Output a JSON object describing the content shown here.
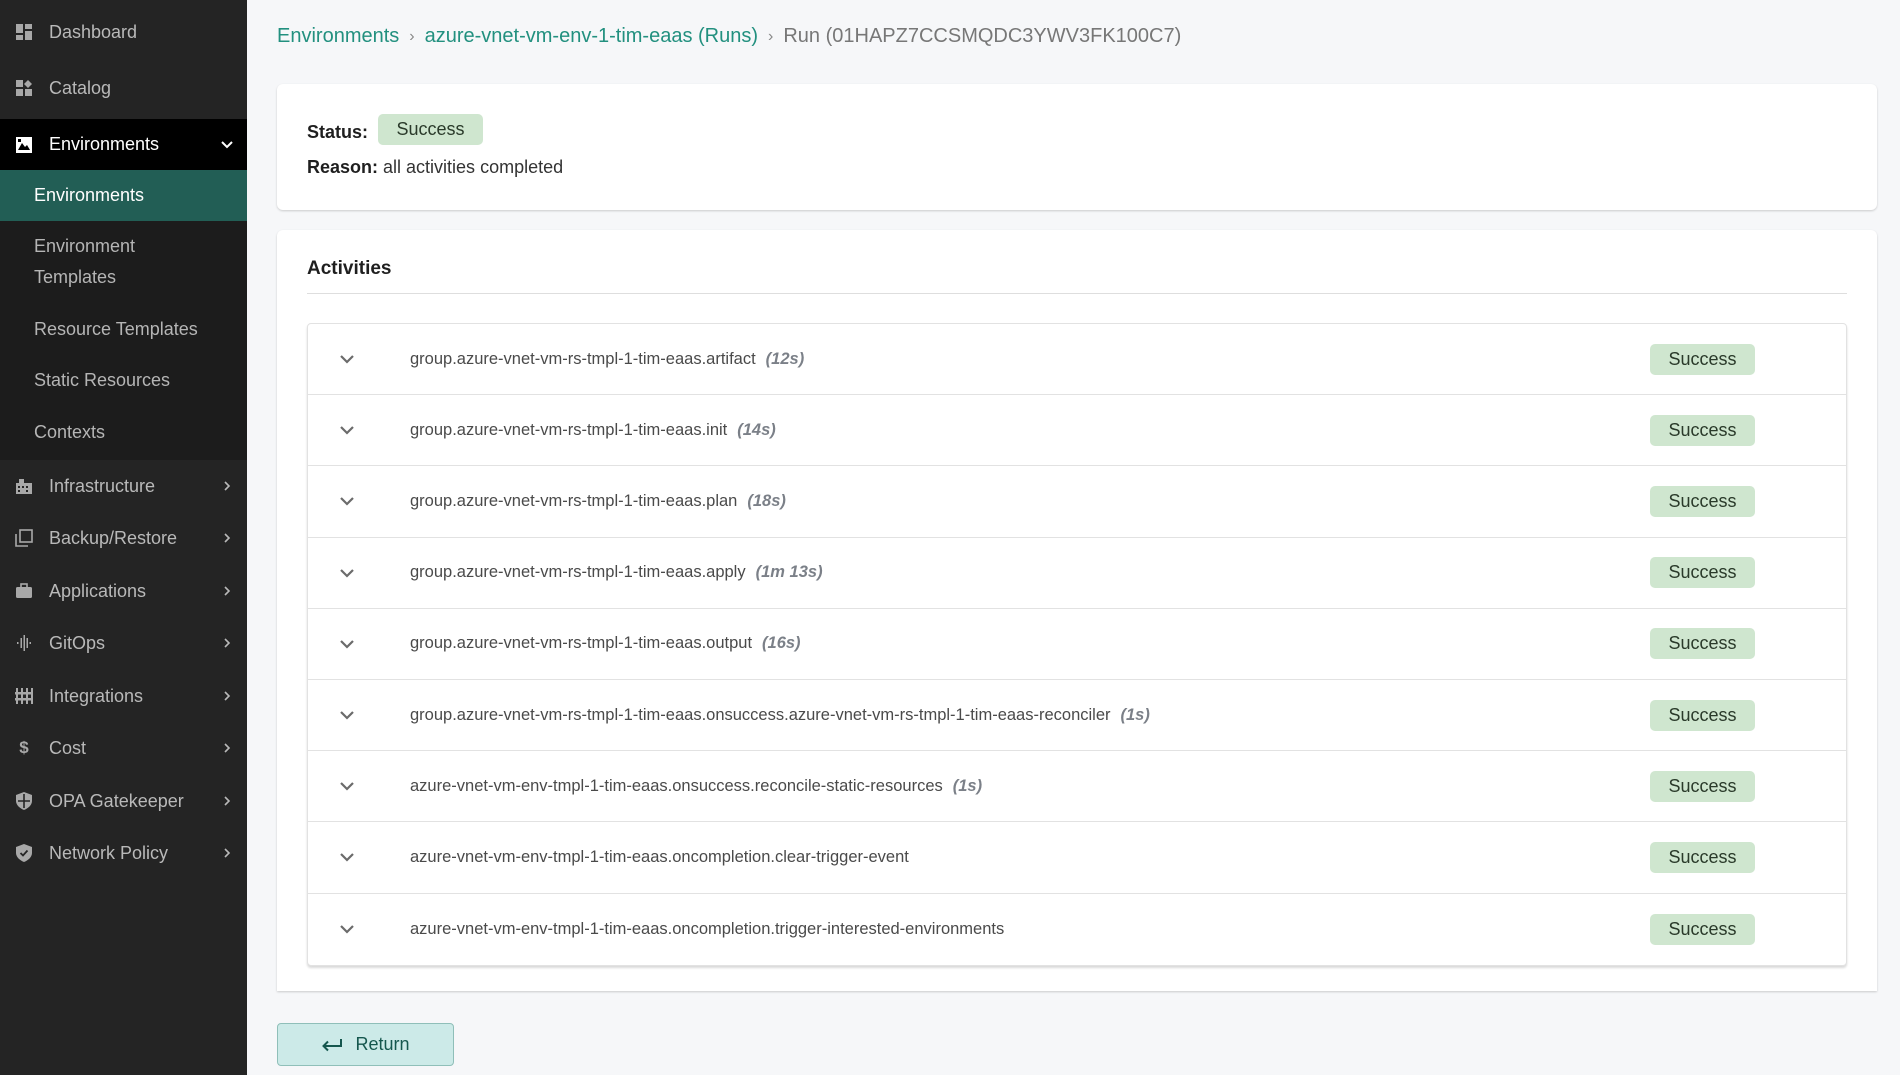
{
  "sidebar": {
    "items": [
      {
        "label": "Dashboard",
        "icon": "dashboard-icon"
      },
      {
        "label": "Catalog",
        "icon": "catalog-icon"
      },
      {
        "label": "Environments",
        "icon": "environments-icon",
        "expanded": true
      },
      {
        "label": "Infrastructure",
        "icon": "infrastructure-icon"
      },
      {
        "label": "Backup/Restore",
        "icon": "backup-restore-icon"
      },
      {
        "label": "Applications",
        "icon": "applications-icon"
      },
      {
        "label": "GitOps",
        "icon": "gitops-icon"
      },
      {
        "label": "Integrations",
        "icon": "integrations-icon"
      },
      {
        "label": "Cost",
        "icon": "cost-icon"
      },
      {
        "label": "OPA Gatekeeper",
        "icon": "opa-gatekeeper-icon"
      },
      {
        "label": "Network Policy",
        "icon": "network-policy-icon"
      }
    ],
    "submenu": [
      {
        "label": "Environments",
        "active": true
      },
      {
        "label_line1": "Environment",
        "label_line2": "Templates"
      },
      {
        "label": "Resource Templates"
      },
      {
        "label": "Static Resources"
      },
      {
        "label": "Contexts"
      }
    ]
  },
  "breadcrumb": {
    "items": [
      "Environments",
      "azure-vnet-vm-env-1-tim-eaas (Runs)"
    ],
    "current": "Run (01HAPZ7CCSMQDC3YWV3FK100C7)",
    "separator": "›"
  },
  "run": {
    "status_label": "Status:",
    "status": "Success",
    "reason_label": "Reason:",
    "reason": "all activities completed"
  },
  "activities": {
    "title": "Activities",
    "items": [
      {
        "name": "group.azure-vnet-vm-rs-tmpl-1-tim-eaas.artifact",
        "duration": "(12s)",
        "status": "Success"
      },
      {
        "name": "group.azure-vnet-vm-rs-tmpl-1-tim-eaas.init",
        "duration": "(14s)",
        "status": "Success"
      },
      {
        "name": "group.azure-vnet-vm-rs-tmpl-1-tim-eaas.plan",
        "duration": "(18s)",
        "status": "Success"
      },
      {
        "name": "group.azure-vnet-vm-rs-tmpl-1-tim-eaas.apply",
        "duration": "(1m 13s)",
        "status": "Success"
      },
      {
        "name": "group.azure-vnet-vm-rs-tmpl-1-tim-eaas.output",
        "duration": "(16s)",
        "status": "Success"
      },
      {
        "name": "group.azure-vnet-vm-rs-tmpl-1-tim-eaas.onsuccess.azure-vnet-vm-rs-tmpl-1-tim-eaas-reconciler",
        "duration": "(1s)",
        "status": "Success"
      },
      {
        "name": "azure-vnet-vm-env-tmpl-1-tim-eaas.onsuccess.reconcile-static-resources",
        "duration": "(1s)",
        "status": "Success"
      },
      {
        "name": "azure-vnet-vm-env-tmpl-1-tim-eaas.oncompletion.clear-trigger-event",
        "duration": "",
        "status": "Success"
      },
      {
        "name": "azure-vnet-vm-env-tmpl-1-tim-eaas.oncompletion.trigger-interested-environments",
        "duration": "",
        "status": "Success"
      }
    ]
  },
  "actions": {
    "return_label": "Return",
    "return_icon": "return-arrow-icon"
  },
  "colors": {
    "accent": "#22907f",
    "sidebar_active": "#225e55",
    "success_badge": "#cfe6cf",
    "return_button": "#cceae8"
  }
}
